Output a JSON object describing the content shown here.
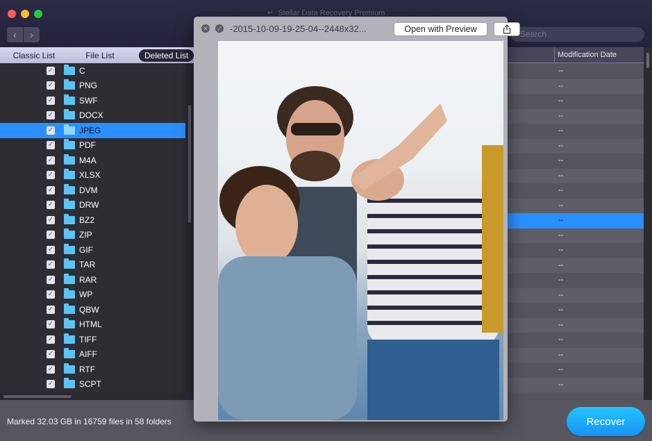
{
  "window": {
    "title": "Stellar Data Recovery Premium",
    "search_placeholder": "Search"
  },
  "tabs": [
    {
      "label": "Classic List",
      "active": false
    },
    {
      "label": "File List",
      "active": false
    },
    {
      "label": "Deleted List",
      "active": true
    }
  ],
  "tree": {
    "items": [
      {
        "label": "C",
        "checked": true
      },
      {
        "label": "PNG",
        "checked": true
      },
      {
        "label": "SWF",
        "checked": true
      },
      {
        "label": "DOCX",
        "checked": true
      },
      {
        "label": "JPEG",
        "checked": true,
        "selected": true
      },
      {
        "label": "PDF",
        "checked": true
      },
      {
        "label": "M4A",
        "checked": true
      },
      {
        "label": "XLSX",
        "checked": true
      },
      {
        "label": "DVM",
        "checked": true
      },
      {
        "label": "DRW",
        "checked": true
      },
      {
        "label": "BZ2",
        "checked": true
      },
      {
        "label": "ZIP",
        "checked": true
      },
      {
        "label": "GIF",
        "checked": true
      },
      {
        "label": "TAR",
        "checked": true
      },
      {
        "label": "RAR",
        "checked": true
      },
      {
        "label": "WP",
        "checked": true
      },
      {
        "label": "QBW",
        "checked": true
      },
      {
        "label": "HTML",
        "checked": true
      },
      {
        "label": "TIFF",
        "checked": true
      },
      {
        "label": "AIFF",
        "checked": true
      },
      {
        "label": "RTF",
        "checked": true
      },
      {
        "label": "SCPT",
        "checked": true
      }
    ]
  },
  "table": {
    "columns": [
      "Size",
      "Modification Date"
    ],
    "visible_header_fragment": "e",
    "rows": [
      "--",
      "--",
      "--",
      "--",
      "--",
      "--",
      "--",
      "--",
      "--",
      "--",
      "--",
      "--",
      "--",
      "--",
      "--",
      "--",
      "--",
      "--",
      "--",
      "--",
      "--",
      "--"
    ],
    "selected_row_index": 10
  },
  "quicklook": {
    "filename": "-2015-10-09-19-25-04--2448x32...",
    "open_label": "Open with Preview",
    "share_icon": "share-icon",
    "close_icon": "close-icon",
    "fullscreen_icon": "fullscreen-icon",
    "image_description": "Photo of three smiling friends outdoors, one framing the camera with her fingers"
  },
  "status": {
    "text": "Marked 32.03 GB in 16759 files in 58 folders"
  },
  "actions": {
    "recover_label": "Recover"
  },
  "colors": {
    "accent": "#2a90ff",
    "recover_button": "#1aa8fa",
    "folder": "#5cc3f5"
  }
}
